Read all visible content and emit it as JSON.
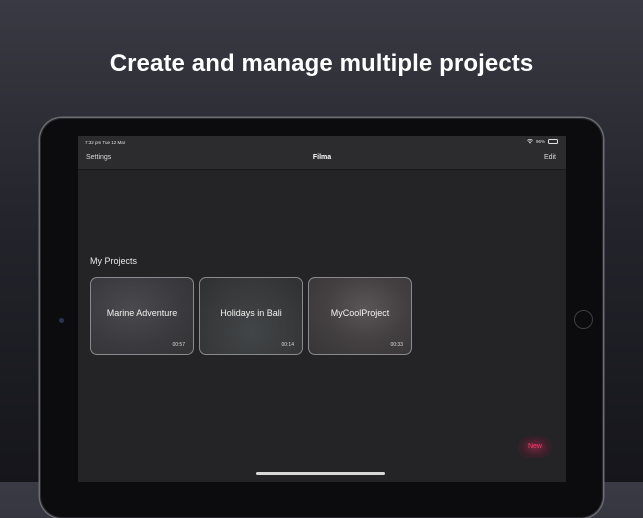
{
  "headline": "Create and manage multiple projects",
  "statusbar": {
    "time": "7:32 pm   Tue 12 Mar",
    "battery": "96%"
  },
  "navbar": {
    "left": "Settings",
    "title": "Filma",
    "right": "Edit"
  },
  "section_title": "My Projects",
  "projects": [
    {
      "name": "Marine Adventure",
      "duration": "00:57"
    },
    {
      "name": "Holidays in Bali",
      "duration": "00:14"
    },
    {
      "name": "MyCoolProject",
      "duration": "00:33"
    }
  ],
  "new_button": "New",
  "colors": {
    "accent": "#ff3b6b",
    "screen_bg": "#242426",
    "navbar_bg": "#2c2c2e"
  },
  "icons": [
    "wifi-icon",
    "battery-icon"
  ]
}
